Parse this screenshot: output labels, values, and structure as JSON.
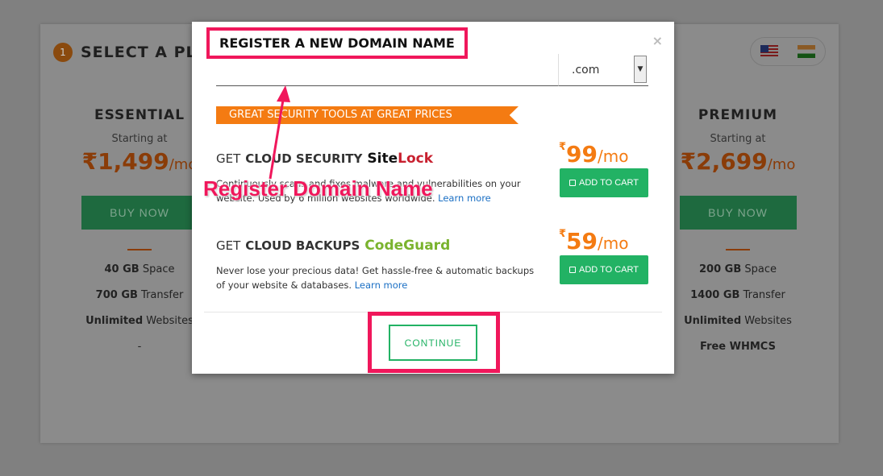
{
  "background": {
    "step_number": "1",
    "step_title": "SELECT A PLAN",
    "flags": [
      {
        "name": "us-flag"
      },
      {
        "name": "india-flag"
      }
    ],
    "plans": [
      {
        "name": "ESSENTIAL",
        "starting": "Starting at",
        "currency": "₹",
        "price": "1,499",
        "unit": "/mo",
        "buy": "BUY NOW",
        "features": [
          [
            "40 GB",
            " Space"
          ],
          [
            "700 GB",
            " Transfer"
          ],
          [
            "Unlimited",
            " Websites"
          ],
          [
            "",
            "-"
          ]
        ]
      },
      {
        "name": "PREMIUM",
        "starting": "Starting at",
        "currency": "₹",
        "price": "2,699",
        "unit": "/mo",
        "buy": "BUY NOW",
        "features": [
          [
            "200 GB",
            " Space"
          ],
          [
            "1400 GB",
            " Transfer"
          ],
          [
            "Unlimited",
            " Websites"
          ],
          [
            "Free WHMCS",
            ""
          ]
        ]
      }
    ]
  },
  "modal": {
    "title": "REGISTER A NEW DOMAIN NAME",
    "close": "×",
    "domain_value": "",
    "tld": ".com",
    "banner": "GREAT SECURITY TOOLS AT GREAT PRICES",
    "offers": [
      {
        "get": "GET",
        "bold": "CLOUD SECURITY",
        "brand1": "Site",
        "brand2": "Lock",
        "brand_color1": "#111111",
        "brand_color2": "#c8202f",
        "desc": "Continuously scans and fixes malware and vulnerabilities on your website. Used by 6 million websites worldwide.",
        "link": "Learn more",
        "currency": "₹",
        "price": "99",
        "unit": "/mo",
        "cart": "ADD TO CART"
      },
      {
        "get": "GET",
        "bold": "CLOUD BACKUPS",
        "brand1": "Code",
        "brand2": "Guard",
        "brand_color1": "#7ab32e",
        "brand_color2": "#7ab32e",
        "desc": "Never lose your precious data! Get hassle-free & automatic backups of your website & databases.",
        "link": "Learn more",
        "currency": "₹",
        "price": "59",
        "unit": "/mo",
        "cart": "ADD TO CART"
      }
    ],
    "continue": "CONTINUE"
  },
  "annotation": "Register Domain Name",
  "colors": {
    "accent_green": "#22b264",
    "orange": "#f47b12",
    "highlight": "#f0175b"
  }
}
